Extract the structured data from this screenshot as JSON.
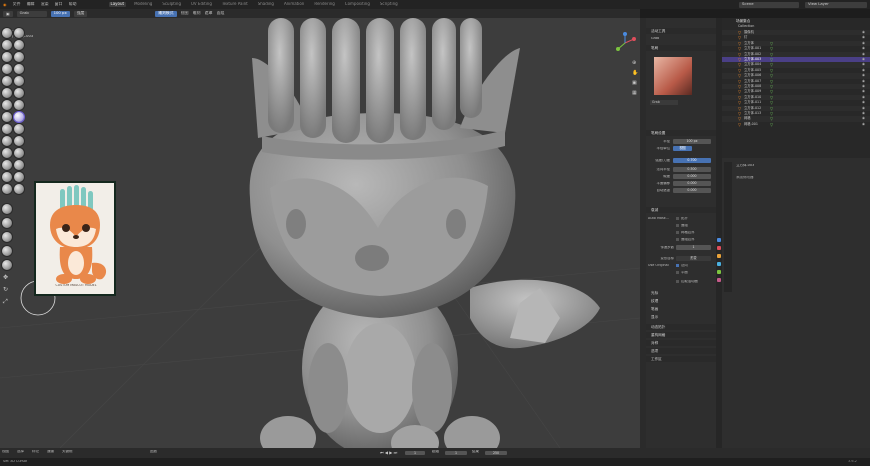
{
  "topbar": {
    "menus": [
      "文件",
      "编辑",
      "渲染",
      "窗口",
      "帮助"
    ],
    "workspaces": [
      "Layout",
      "Modeling",
      "Sculpting",
      "UV Editing",
      "Texture Paint",
      "Shading",
      "Animation",
      "Rendering",
      "Compositing",
      "Scripting"
    ],
    "active_workspace": "Layout",
    "scene_label": "Scene",
    "view_layer_label": "View Layer"
  },
  "header2": {
    "brush_name": "Grab",
    "radius": "100 px",
    "strength_label": "强度",
    "mode": "雕刻模式",
    "view": "视图",
    "sculpt": "雕刻",
    "mask": "遮罩",
    "face_sets": "面组",
    "select_label": "选择",
    "search_placeholder": "Models ▾"
  },
  "viewport": {
    "view_name": "用户透视",
    "object_name": "(1) 立方体.003",
    "ref_caption": "CUSTOM MASCOT MODEL"
  },
  "properties": {
    "active_tool": "活动工具",
    "brush_section": "笔刷",
    "brush_name": "Grab",
    "brush_settings": "笔刷设置",
    "radius_label": "半径",
    "radius_val": "100 px",
    "radius_unit_label": "半径单位",
    "radius_unit_val": "视图",
    "strength_label": "强度/力度",
    "strength_val": "0.700",
    "normal_radius_label": "法向半径",
    "normal_radius_val": "0.500",
    "hardness_label": "硬度",
    "hardness_val": "0.000",
    "plane_label": "平面偏移",
    "plane_val": "0.000",
    "auto_label": "自动遮罩",
    "auto_val": "0.000",
    "falloff_section": "衰减",
    "automasking": "Auto Mask...",
    "topology": "拓扑",
    "face_sets": "面组",
    "mesh_boundary": "网格边界",
    "face_boundary": "面组边界",
    "propagation_label": "传递步数",
    "propagation_val": "1",
    "deformation_label": "变形目标",
    "deformation_val": "形变",
    "use_original": "Use Original",
    "orig_normal": "法向",
    "orig_plane": "平面",
    "grab_active": "拉取活动面",
    "cursor_section": "光标",
    "texture_section": "纹理",
    "stroke_section": "笔画",
    "falloff2_section": "衰减",
    "display_section": "显示",
    "dyntopo_section": "动态拓扑",
    "remesh_section": "重构网格",
    "symmetry_section": "对称",
    "options_section": "选项",
    "workspace_section": "工作区"
  },
  "outliner": {
    "title": "场景集合",
    "collection": "Collection",
    "items": [
      "摄像机",
      "灯",
      "立方体",
      "立方体.001",
      "立方体.002",
      "立方体.003",
      "立方体.004",
      "立方体.005",
      "立方体.006",
      "立方体.007",
      "立方体.008",
      "立方体.009",
      "立方体.010",
      "立方体.011",
      "立方体.012",
      "立方体.013",
      "网格",
      "网格.001"
    ]
  },
  "lower_right": {
    "object_name": "立方体.003",
    "tab_label": "添加修改器"
  },
  "bottom": {
    "items": [
      "视图",
      "选择",
      "标记",
      "通道",
      "关键帧"
    ],
    "playback": "回放",
    "frame": "1",
    "start_label": "起始",
    "start": "1",
    "end_label": "结束",
    "end": "250"
  },
  "status": {
    "left": "Set 3D Cursor",
    "right": "3.6.2"
  }
}
